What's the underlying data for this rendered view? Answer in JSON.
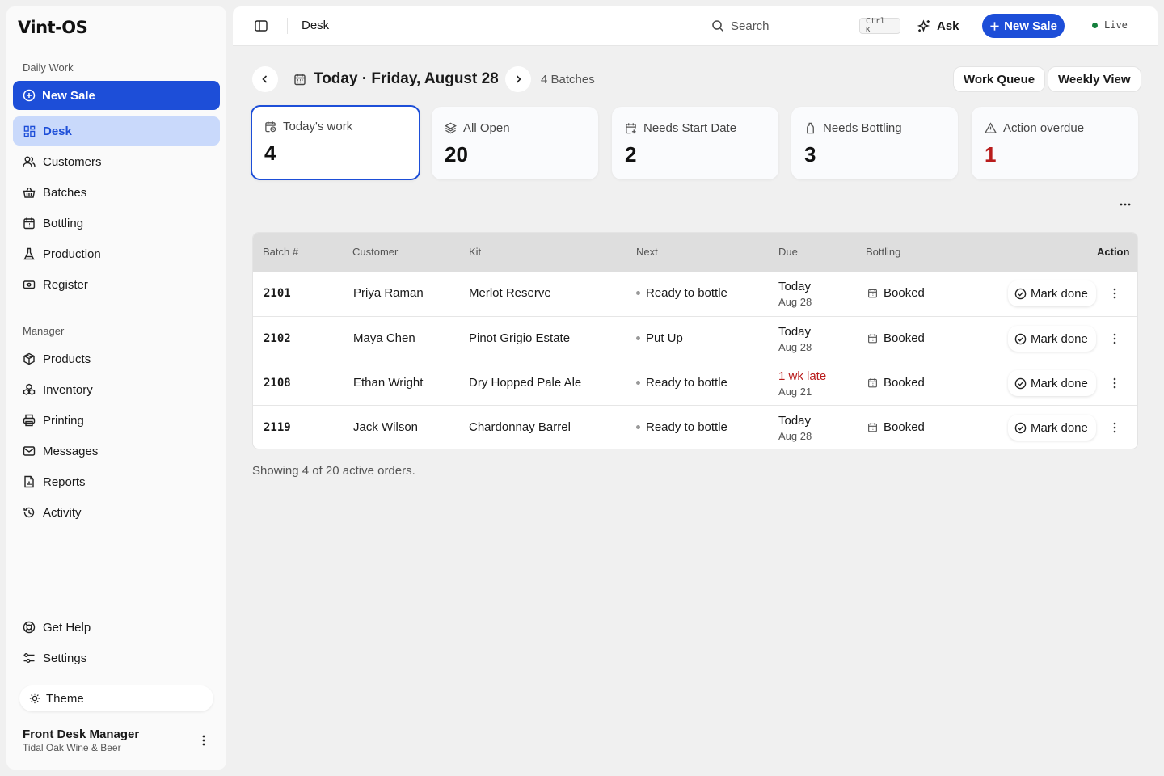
{
  "app": {
    "logo_text": "Vint-OS"
  },
  "sidebar": {
    "section_daily": "Daily Work",
    "new_sale": "New Sale",
    "daily_items": [
      {
        "label": "Desk",
        "icon": "dashboard-icon",
        "active": true
      },
      {
        "label": "Customers",
        "icon": "users-icon"
      },
      {
        "label": "Batches",
        "icon": "basket-icon"
      },
      {
        "label": "Bottling",
        "icon": "calendar-grid-icon"
      },
      {
        "label": "Production",
        "icon": "flask-icon"
      },
      {
        "label": "Register",
        "icon": "cash-register-icon"
      }
    ],
    "section_manager": "Manager",
    "manager_items": [
      {
        "label": "Products",
        "icon": "box-icon"
      },
      {
        "label": "Inventory",
        "icon": "boxes-icon"
      },
      {
        "label": "Printing",
        "icon": "printer-icon"
      },
      {
        "label": "Messages",
        "icon": "mail-icon"
      },
      {
        "label": "Reports",
        "icon": "report-icon"
      },
      {
        "label": "Activity",
        "icon": "history-icon"
      }
    ],
    "footer_items": [
      {
        "label": "Get Help",
        "icon": "lifebuoy-icon"
      },
      {
        "label": "Settings",
        "icon": "settings-icon"
      }
    ],
    "theme": "Theme",
    "user": {
      "name": "Front Desk Manager",
      "org": "Tidal Oak Wine & Beer"
    }
  },
  "topbar": {
    "title": "Desk",
    "search_placeholder": "Search",
    "shortcut": "Ctrl K",
    "ask": "Ask",
    "new_sale": "New Sale",
    "status": "Live"
  },
  "header": {
    "date_title": "Today · Friday, August 28",
    "batch_count": "4 Batches",
    "work_queue": "Work Queue",
    "weekly_view": "Weekly View"
  },
  "cards": [
    {
      "label": "Today's work",
      "value": "4",
      "icon": "calendar-clock-icon",
      "selected": true
    },
    {
      "label": "All Open",
      "value": "20",
      "icon": "layers-icon"
    },
    {
      "label": "Needs Start Date",
      "value": "2",
      "icon": "calendar-plus-icon"
    },
    {
      "label": "Needs Bottling",
      "value": "3",
      "icon": "bottle-icon"
    },
    {
      "label": "Action overdue",
      "value": "1",
      "icon": "alert-triangle-icon",
      "alert": true
    }
  ],
  "table": {
    "columns": [
      "Batch #",
      "Customer",
      "Kit",
      "Next",
      "Due",
      "Bottling",
      "Action"
    ],
    "rows": [
      {
        "batch": "2101",
        "customer": "Priya Raman",
        "kit": "Merlot Reserve",
        "next": "Ready to bottle",
        "due_main": "Today",
        "due_sub": "Aug 28",
        "late": false,
        "bottling": "Booked",
        "action": "Mark done"
      },
      {
        "batch": "2102",
        "customer": "Maya Chen",
        "kit": "Pinot Grigio Estate",
        "next": "Put Up",
        "due_main": "Today",
        "due_sub": "Aug 28",
        "late": false,
        "bottling": "Booked",
        "action": "Mark done"
      },
      {
        "batch": "2108",
        "customer": "Ethan Wright",
        "kit": "Dry Hopped Pale Ale",
        "next": "Ready to bottle",
        "due_main": "1 wk late",
        "due_sub": "Aug 21",
        "late": true,
        "bottling": "Booked",
        "action": "Mark done"
      },
      {
        "batch": "2119",
        "customer": "Jack Wilson",
        "kit": "Chardonnay Barrel",
        "next": "Ready to bottle",
        "due_main": "Today",
        "due_sub": "Aug 28",
        "late": false,
        "bottling": "Booked",
        "action": "Mark done"
      }
    ],
    "footer": "Showing 4 of 20 active orders."
  },
  "colors": {
    "accent": "#1d4ed8",
    "alert": "#b91c1c",
    "live": "#15803d"
  }
}
